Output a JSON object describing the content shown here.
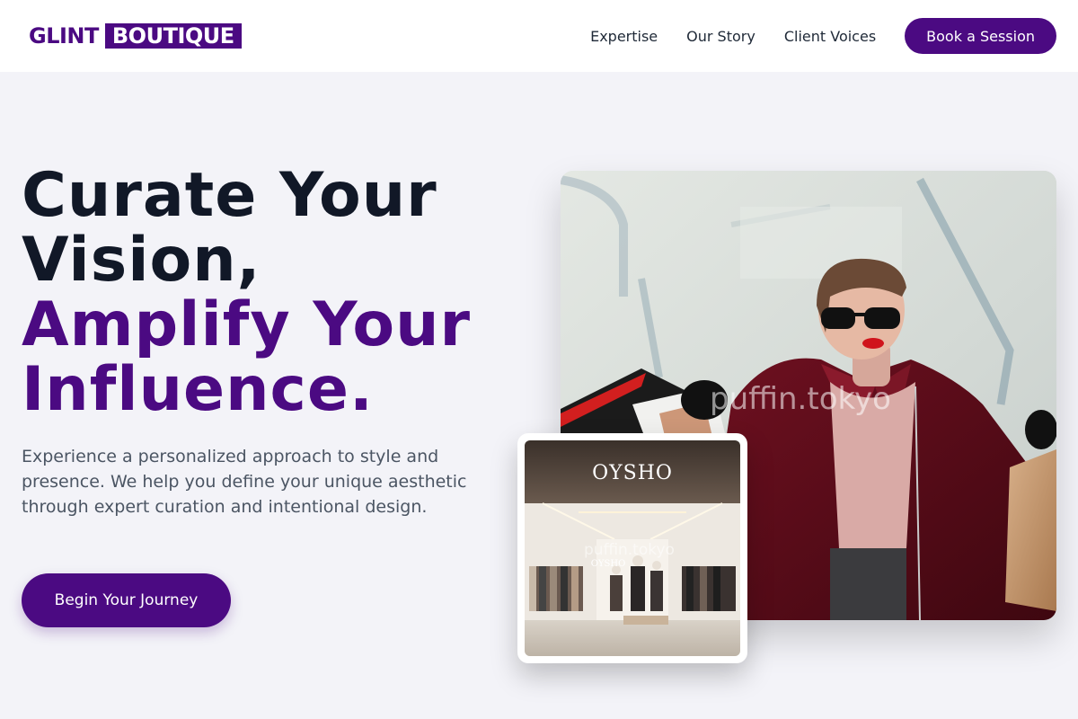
{
  "brand": {
    "part1": "GLINT",
    "part2": "BOUTIQUE"
  },
  "nav": {
    "items": [
      "Expertise",
      "Our Story",
      "Client Voices"
    ],
    "cta": "Book a Session"
  },
  "hero": {
    "line1": "Curate Your",
    "line2": "Vision,",
    "line3": "Amplify Your",
    "line4": "Influence.",
    "description": "Experience a personalized approach to style and presence. We help you define your unique aesthetic through expert curation and intentional design.",
    "cta": "Begin Your Journey"
  },
  "images": {
    "main_watermark": "puffin.tokyo",
    "inset_watermark": "puffin.tokyo",
    "inset_sign": "OYSHO",
    "inset_sign_small": "OYSHO"
  },
  "colors": {
    "accent": "#4b0a82",
    "background": "#f3f3f8",
    "heading": "#111827",
    "body_text": "#4b5563"
  }
}
